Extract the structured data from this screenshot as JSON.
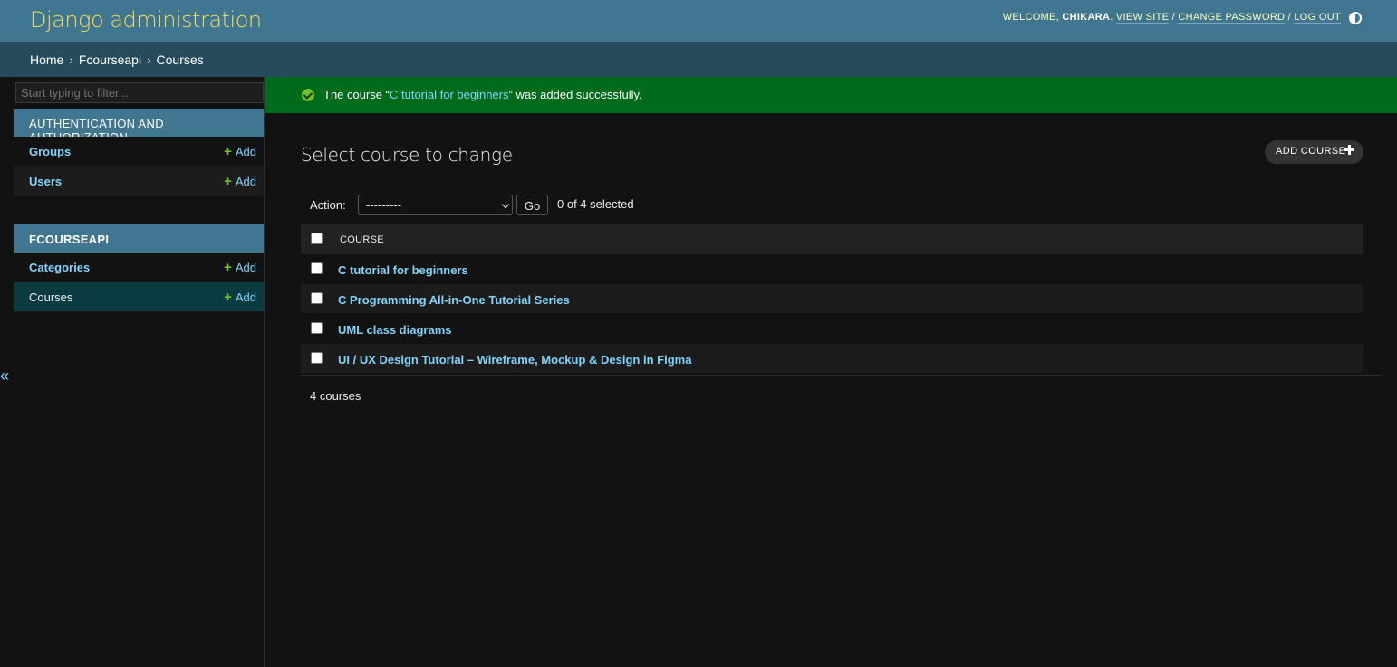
{
  "header": {
    "branding": "Django administration",
    "welcome": "Welcome,",
    "username": "Chikara",
    "view_site": "View site",
    "change_password": "Change password",
    "log_out": "Log out",
    "separator": "/"
  },
  "breadcrumbs": {
    "home": "Home",
    "app": "Fcourseapi",
    "current": "Courses",
    "sep": "›"
  },
  "sidebar": {
    "filter_placeholder": "Start typing to filter...",
    "apps": [
      {
        "caption": "AUTHENTICATION AND AUTHORIZATION",
        "models": [
          {
            "name": "Groups",
            "add": "Add"
          },
          {
            "name": "Users",
            "add": "Add"
          }
        ]
      },
      {
        "caption": "FCOURSEAPI",
        "models": [
          {
            "name": "Categories",
            "add": "Add"
          },
          {
            "name": "Courses",
            "add": "Add"
          }
        ]
      }
    ],
    "toggle": "«"
  },
  "message": {
    "prefix": "The course “",
    "link": "C tutorial for beginners",
    "suffix": "” was added successfully."
  },
  "content": {
    "title": "Select course to change",
    "add_button": "Add course"
  },
  "actions": {
    "label": "Action:",
    "selected_option": "---------",
    "go": "Go",
    "counter": "0 of 4 selected"
  },
  "table": {
    "column": "COURSE",
    "rows": [
      "C tutorial for beginners",
      "C Programming All-in-One Tutorial Series",
      "UML class diagrams",
      "UI / UX Design Tutorial – Wireframe, Mockup & Design in Figma"
    ]
  },
  "paginator": "4 courses",
  "colors": {
    "header": "#417690",
    "breadcrumbs": "#264b5d",
    "branding": "#f5dd5d",
    "link": "#81d4fa",
    "success": "#006b1b",
    "add_icon": "#70bf2b",
    "background": "#121212"
  }
}
